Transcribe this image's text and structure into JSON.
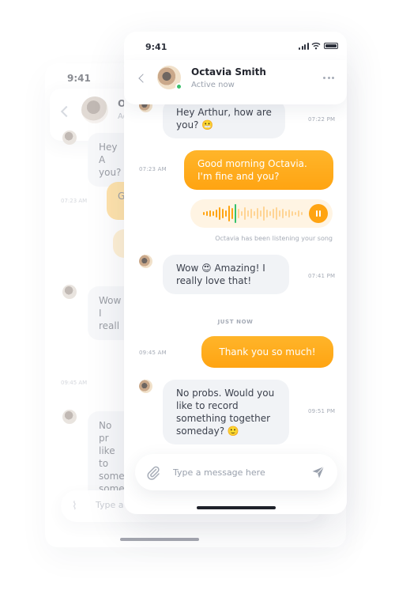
{
  "back_screen": {
    "time": "9:41",
    "name": "Oc",
    "status": "Act",
    "messages": [
      {
        "text": "Hey A\nyou?"
      },
      {
        "text": "G"
      },
      {
        "text": "Wow\nI reall"
      },
      {
        "text": "No pr\nlike to\nsome\nsomed"
      }
    ],
    "times": [
      "07:23 AM",
      "09:45 AM"
    ],
    "input_placeholder": "Type a"
  },
  "status_bar": {
    "time": "9:41"
  },
  "header": {
    "contact_name": "Octavia Smith",
    "contact_status": "Active now"
  },
  "messages": [
    {
      "id": "m1",
      "direction": "in",
      "text": "Hey Arthur, how are you? 😬",
      "time": "07:22 PM"
    },
    {
      "id": "m2",
      "direction": "out",
      "text": "Good morning Octavia. I'm fine and you?",
      "time": "07:23 AM"
    },
    {
      "id": "m3",
      "direction": "in",
      "text": "Wow 😍 Amazing! I really love that!",
      "time": "07:41 PM"
    },
    {
      "id": "m4",
      "direction": "out",
      "text": "Thank you so much!",
      "time": "09:45 AM"
    },
    {
      "id": "m5",
      "direction": "in",
      "text": "No probs. Would you like to record something together someday? 🙂",
      "time": "09:51 PM"
    }
  ],
  "voice_message": {
    "note": "Octavia has been listening your song",
    "progress": 0.35
  },
  "divider_label": "JUST NOW",
  "composer": {
    "placeholder": "Type a message here"
  },
  "colors": {
    "accent": "#FFA412",
    "bubble_in": "#F1F3F6",
    "online": "#3BBF6C"
  }
}
